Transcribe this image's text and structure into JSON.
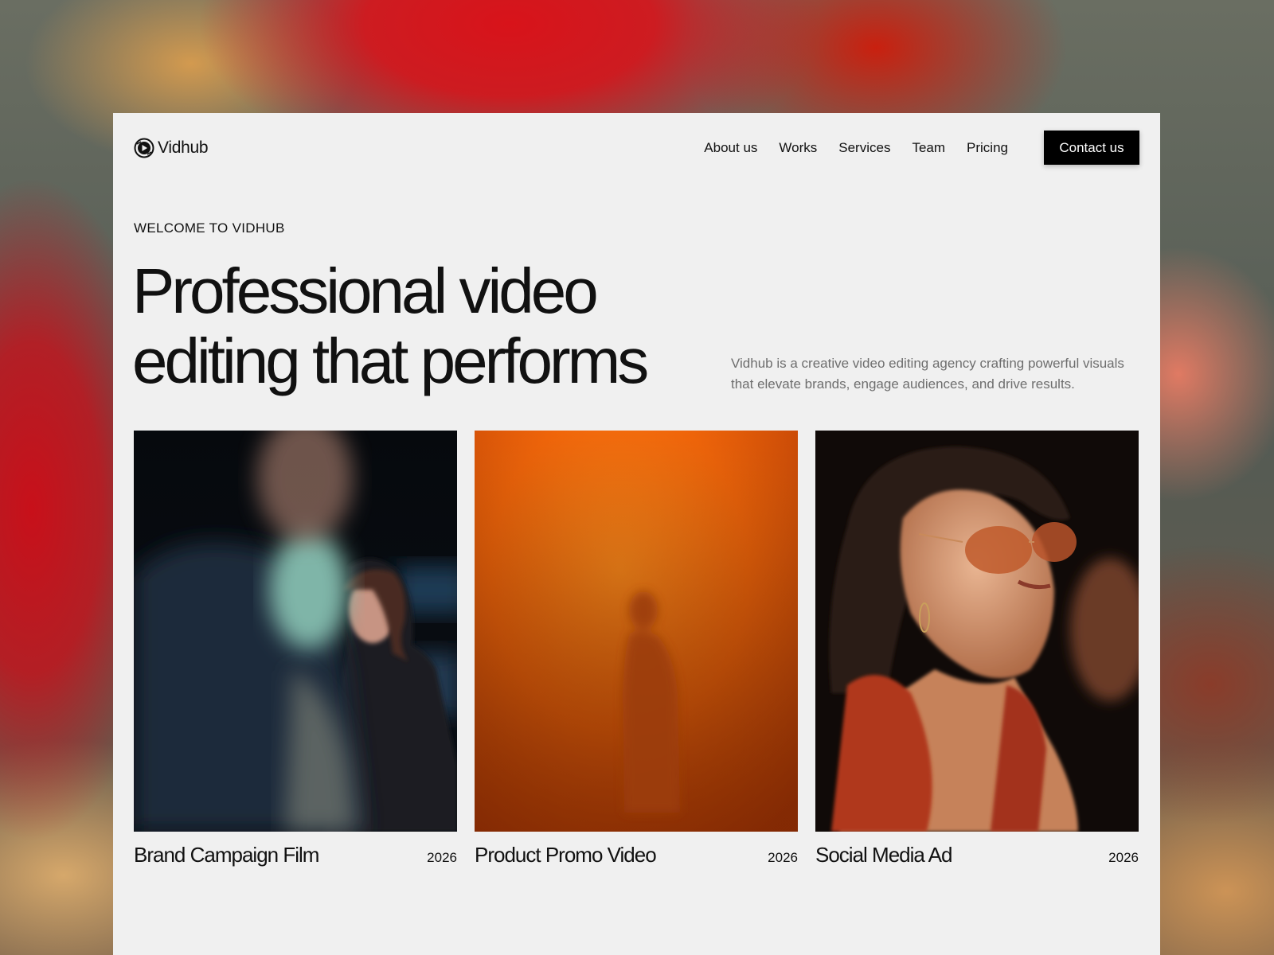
{
  "brand": {
    "name": "Vidhub",
    "logo_icon": "play-lens-icon"
  },
  "nav": {
    "links": [
      "About us",
      "Works",
      "Services",
      "Team",
      "Pricing"
    ],
    "cta": "Contact us"
  },
  "hero": {
    "eyebrow": "WELCOME TO VIDHUB",
    "headline_line1": "Professional video",
    "headline_line2": "editing that performs",
    "description": "Vidhub is a creative video editing agency crafting powerful visuals that elevate brands, engage audiences, and drive results."
  },
  "works": [
    {
      "title": "Brand Campaign Film",
      "year": "2026"
    },
    {
      "title": "Product Promo Video",
      "year": "2026"
    },
    {
      "title": "Social Media Ad",
      "year": "2026"
    }
  ],
  "colors": {
    "card_bg": "#f0f0f0",
    "cta_bg": "#000000",
    "text": "#111111",
    "muted": "#6e6e6e"
  }
}
